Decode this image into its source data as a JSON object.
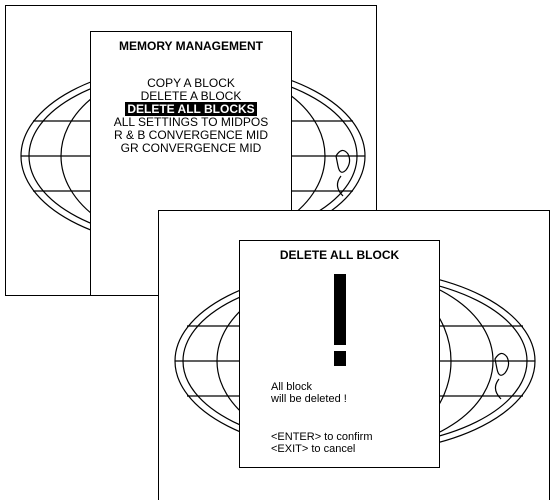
{
  "screen1": {
    "menu_title": "MEMORY MANAGEMENT",
    "items": [
      {
        "label": "COPY A BLOCK",
        "selected": false
      },
      {
        "label": "DELETE A BLOCK",
        "selected": false
      },
      {
        "label": "DELETE ALL BLOCKS",
        "selected": true
      },
      {
        "label": "ALL SETTINGS TO MIDPOS",
        "selected": false
      },
      {
        "label": "R & B CONVERGENCE MID",
        "selected": false
      },
      {
        "label": "GR CONVERGENCE MID",
        "selected": false
      }
    ]
  },
  "screen2": {
    "dialog_title": "DELETE ALL BLOCK",
    "message_line1": "All block",
    "message_line2": "will be deleted !",
    "enter_hint": "<ENTER> to confirm",
    "exit_hint": "<EXIT> to cancel"
  },
  "colors": {
    "foreground": "#000000",
    "background": "#ffffff",
    "highlight_bg": "#000000",
    "highlight_fg": "#ffffff"
  },
  "icons": [
    "globe-icon",
    "exclamation-icon"
  ]
}
